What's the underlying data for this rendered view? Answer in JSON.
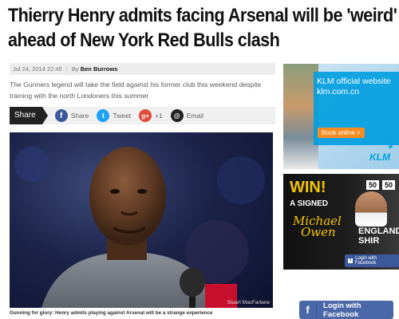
{
  "headline": {
    "line1": "Thierry Henry admits facing Arsenal will be 'weird'",
    "line2": "ahead of New York Red Bulls clash"
  },
  "meta": {
    "date": "Jul 24, 2014 22:45",
    "separator": "|",
    "byline_prefix": "By",
    "author": "Ben Burrows"
  },
  "standfirst": "The Gunners legend will take the field against his former club this weekend despite training with the north Londoners this summer",
  "share": {
    "label": "Share",
    "facebook_icon": "f",
    "facebook_label": "Share",
    "twitter_icon": "t",
    "twitter_label": "Tweet",
    "gplus_icon": "g+",
    "gplus_label": "+1",
    "email_icon": "@",
    "email_label": "Email"
  },
  "photo": {
    "credit": "Stuart MacFarlane"
  },
  "caption": "Gunning for glory: Henry admits playing against Arsenal will be a strange experience",
  "ads": {
    "klm": {
      "line1": "KLM official website",
      "line2": "klm.com.cn",
      "button": "Book online >",
      "logo": "KLM",
      "crown": "♛"
    },
    "owen": {
      "win": "WIN!",
      "badge1": "50",
      "badge2": "50",
      "signed": "A SIGNED",
      "signature_line1": "Michael",
      "signature_line2": "Owen",
      "england1": "ENGLAND",
      "england2": "SHIR",
      "fb_icon": "f",
      "fb_login": "Login with Facebook"
    }
  },
  "fb_login": {
    "icon": "f",
    "label": "Login with Facebook"
  },
  "colors": {
    "facebook": "#3b5998",
    "twitter": "#1da1f2",
    "gplus": "#dd4b39",
    "klm_blue": "#00a1de",
    "win_yellow": "#f5c400"
  }
}
